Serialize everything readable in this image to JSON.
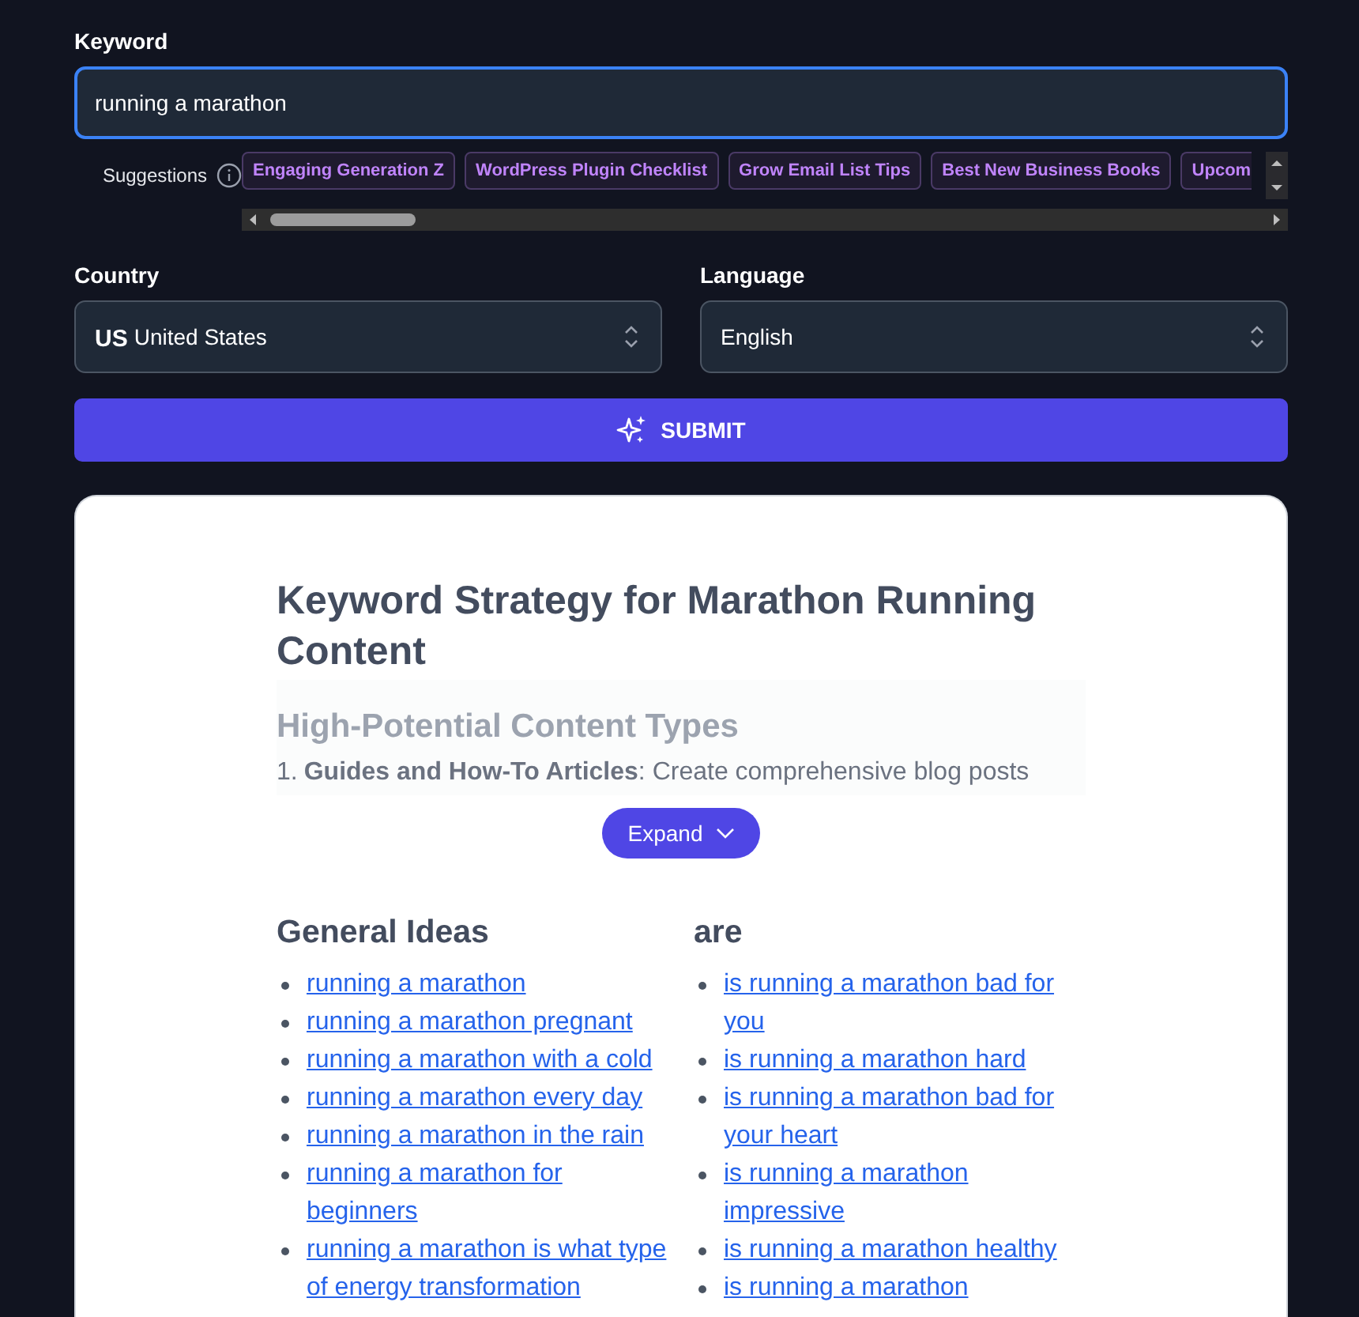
{
  "keyword": {
    "label": "Keyword",
    "value": "running a marathon",
    "focused": true
  },
  "suggestions": {
    "label": "Suggestions",
    "chips": [
      {
        "text": "Engaging Generation Z",
        "cut": false
      },
      {
        "text": "WordPress Plugin Checklist",
        "cut": false
      },
      {
        "text": "Grow Email List Tips",
        "cut": false
      },
      {
        "text": "Best New Business Books",
        "cut": false
      },
      {
        "text": "Upcom",
        "cut": true
      }
    ]
  },
  "country": {
    "label": "Country",
    "flag": "US",
    "value": "United States"
  },
  "language": {
    "label": "Language",
    "value": "English"
  },
  "submit": {
    "label": "SUBMIT"
  },
  "result": {
    "title": "Keyword Strategy for Marathon Running Content",
    "preview": {
      "heading": "High-Potential Content Types",
      "items": [
        {
          "number": "1.",
          "text": "**Guides and How-To Articles**: Create comprehensive blog posts"
        }
      ]
    },
    "expand": {
      "label": "Expand",
      "expanded": false
    },
    "groups": [
      {
        "heading": "General Ideas",
        "links": [
          "running a marathon",
          "running a marathon pregnant",
          "running a marathon with a cold",
          "running a marathon every day",
          "running a marathon in the rain",
          "running a marathon for beginners",
          "running a marathon is what type of energy transformation"
        ]
      },
      {
        "heading": "are",
        "links": [
          "is running a marathon bad for you",
          "is running a marathon hard",
          "is running a marathon bad for your heart",
          "is running a marathon impressive",
          "is running a marathon healthy",
          "is running a marathon"
        ]
      }
    ]
  }
}
